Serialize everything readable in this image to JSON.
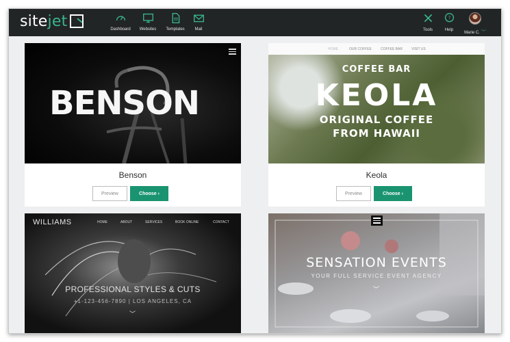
{
  "app": {
    "logo_text_a": "site",
    "logo_text_b": "jet",
    "accent_color": "#38b48f"
  },
  "nav": {
    "dashboard": "Dashboard",
    "websites": "Websites",
    "templates": "Templates",
    "mail": "Mail",
    "tools": "Tools",
    "help": "Help",
    "user": "Marie C."
  },
  "templates": [
    {
      "name": "Benson",
      "hero_text": "BENSON",
      "preview_label": "Preview",
      "choose_label": "Choose ›"
    },
    {
      "name": "Keola",
      "menu": [
        "HOME",
        "OUR COFFEE",
        "COFFEE BAR",
        "VISIT US"
      ],
      "line1": "COFFEE BAR",
      "line2": "KEOLA",
      "line3": "ORIGINAL COFFEE",
      "line4": "FROM HAWAII",
      "preview_label": "Preview",
      "choose_label": "Choose ›"
    },
    {
      "name": "Williams",
      "logo": "WILLIAMS",
      "menu": [
        "HOME",
        "ABOUT",
        "SERVICES",
        "BOOK ONLINE",
        "CONTACT"
      ],
      "headline": "PROFESSIONAL STYLES & CUTS",
      "subline": "+1-123-456-7890 | LOS ANGELES, CA"
    },
    {
      "name": "Sensation Events",
      "headline": "SENSATION EVENTS",
      "subline": "YOUR FULL SERVICE EVENT AGENCY"
    }
  ]
}
